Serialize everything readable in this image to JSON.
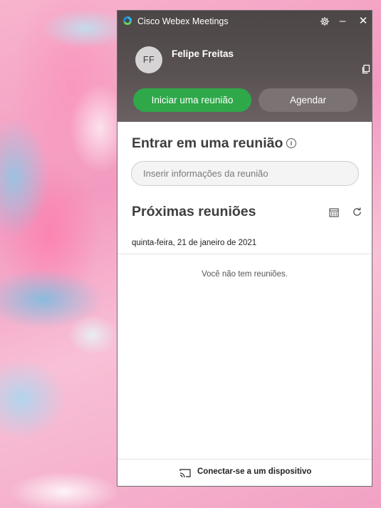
{
  "window": {
    "title": "Cisco Webex Meetings",
    "icons": {
      "app_logo": "webex-logo",
      "settings": "gear-icon",
      "minimize": "minimize-icon",
      "close": "close-icon"
    },
    "minimize_glyph": "–",
    "close_glyph": "✕"
  },
  "user": {
    "initials": "FF",
    "name": "Felipe Freitas"
  },
  "actions": {
    "start_label": "Iniciar uma reunião",
    "schedule_label": "Agendar"
  },
  "join": {
    "title": "Entrar em uma reunião",
    "info_glyph": "i",
    "input_placeholder": "Inserir informações da reunião",
    "input_value": ""
  },
  "upcoming": {
    "title": "Próximas reuniões",
    "date": "quinta-feira, 21 de janeiro de 2021",
    "empty_message": "Você não tem reuniões."
  },
  "footer": {
    "connect_label": "Conectar-se a um dispositivo"
  },
  "colors": {
    "start_button": "#2fa84a",
    "schedule_button": "#7b7273",
    "header_bg": "#4c4647"
  }
}
